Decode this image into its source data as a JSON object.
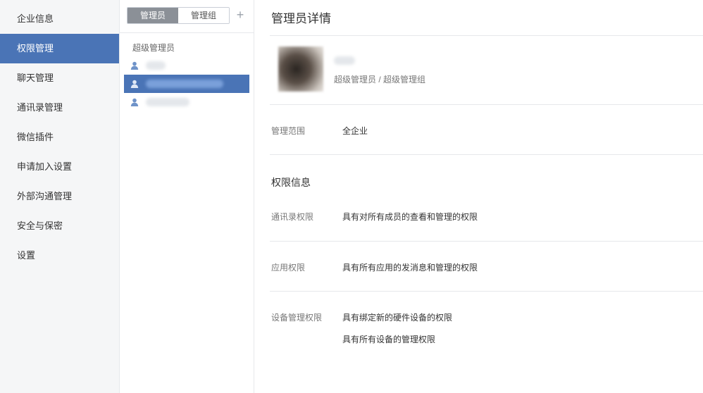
{
  "sidebar": {
    "items": [
      {
        "label": "企业信息"
      },
      {
        "label": "权限管理",
        "active": true
      },
      {
        "label": "聊天管理"
      },
      {
        "label": "通讯录管理"
      },
      {
        "label": "微信插件"
      },
      {
        "label": "申请加入设置"
      },
      {
        "label": "外部沟通管理"
      },
      {
        "label": "安全与保密"
      },
      {
        "label": "设置"
      }
    ]
  },
  "middle": {
    "tabs": [
      {
        "label": "管理员",
        "active": true
      },
      {
        "label": "管理组"
      }
    ],
    "add_label": "+",
    "group_label": "超级管理员",
    "members_selected_index": 1
  },
  "details": {
    "title": "管理员详情",
    "role": "超级管理员 / 超级管理组",
    "scope_label": "管理范围",
    "scope_value": "全企业",
    "permissions_title": "权限信息",
    "permissions": [
      {
        "label": "通讯录权限",
        "values": [
          "具有对所有成员的查看和管理的权限"
        ]
      },
      {
        "label": "应用权限",
        "values": [
          "具有所有应用的发消息和管理的权限"
        ]
      },
      {
        "label": "设备管理权限",
        "values": [
          "具有绑定新的硬件设备的权限",
          "具有所有设备的管理权限"
        ]
      }
    ]
  },
  "colors": {
    "accent": "#4a74b6",
    "tab_active": "#8b9097",
    "sidebar_bg": "#f5f6f7"
  },
  "icons": {
    "member": "user-icon",
    "add": "plus-icon"
  }
}
